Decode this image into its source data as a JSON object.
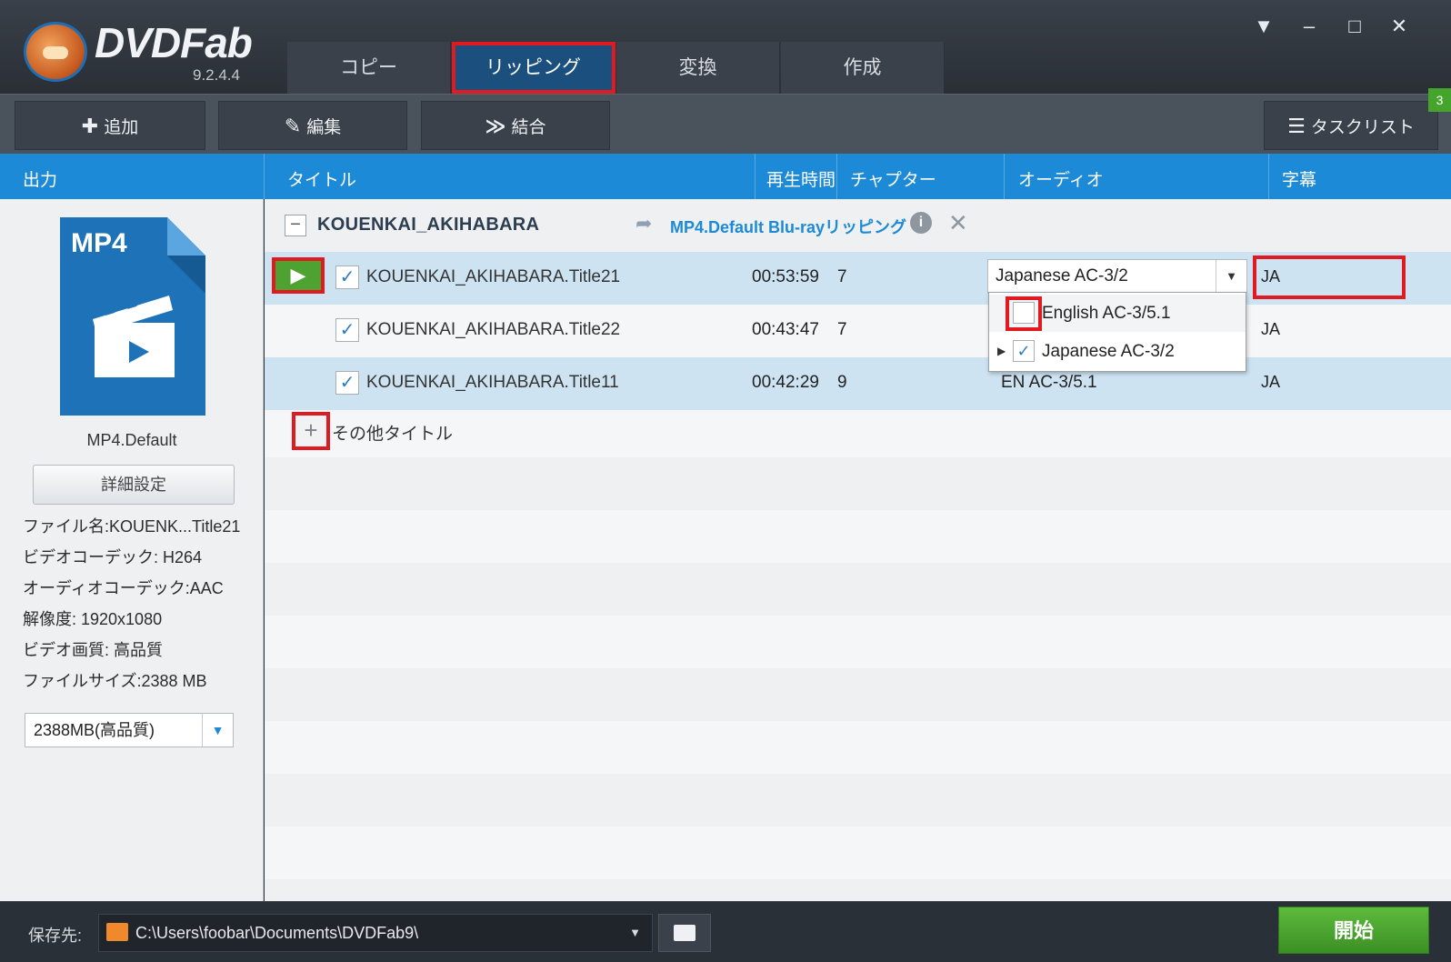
{
  "app": {
    "name": "DVDFab",
    "version": "9.2.4.4"
  },
  "window_controls": [
    "▼",
    "–",
    "□",
    "✕"
  ],
  "main_tabs": [
    {
      "label": "コピー"
    },
    {
      "label": "リッピング",
      "active": true
    },
    {
      "label": "変換"
    },
    {
      "label": "作成"
    }
  ],
  "toolbar": {
    "add_label": "追加",
    "edit_label": "編集",
    "merge_label": "結合",
    "tasklist_label": "タスクリスト",
    "tasklist_badge": "3"
  },
  "columns": {
    "output": "出力",
    "title": "タイトル",
    "duration": "再生時間",
    "chapters": "チャプター",
    "audio": "オーディオ",
    "subtitle": "字幕"
  },
  "profile": {
    "icon_text": "MP4",
    "name": "MP4.Default",
    "detail_button": "詳細設定",
    "info": [
      "ファイル名:KOUENK...Title21",
      "ビデオコーデック: H264",
      "オーディオコーデック:AAC",
      "解像度: 1920x1080",
      "ビデオ画質: 高品質",
      "ファイルサイズ:2388 MB"
    ],
    "size_select": "2388MB(高品質)"
  },
  "group": {
    "collapse": "−",
    "title": "KOUENKAI_AKIHABARA",
    "link": "MP4.Default Blu-rayリッピング"
  },
  "titles": [
    {
      "name": "KOUENKAI_AKIHABARA.Title21",
      "duration": "00:53:59",
      "chapters": "7",
      "audio": "Japanese AC-3/2",
      "subtitle": "JA"
    },
    {
      "name": "KOUENKAI_AKIHABARA.Title22",
      "duration": "00:43:47",
      "chapters": "7",
      "audio": "",
      "subtitle": "JA"
    },
    {
      "name": "KOUENKAI_AKIHABARA.Title11",
      "duration": "00:42:29",
      "chapters": "9",
      "audio": "EN AC-3/5.1",
      "subtitle": "JA"
    }
  ],
  "audio_dropdown": [
    {
      "label": "English AC-3/5.1",
      "checked": false
    },
    {
      "label": "Japanese AC-3/2",
      "checked": true
    }
  ],
  "more_titles": {
    "plus": "+",
    "label": "その他タイトル"
  },
  "bottom": {
    "save_label": "保存先:",
    "path": "C:\\Users\\foobar\\Documents\\DVDFab9\\",
    "start_button": "開始"
  },
  "colors": {
    "accent": "#1c8ad6",
    "highlight": "#e11a22",
    "start": "#45a42c"
  }
}
